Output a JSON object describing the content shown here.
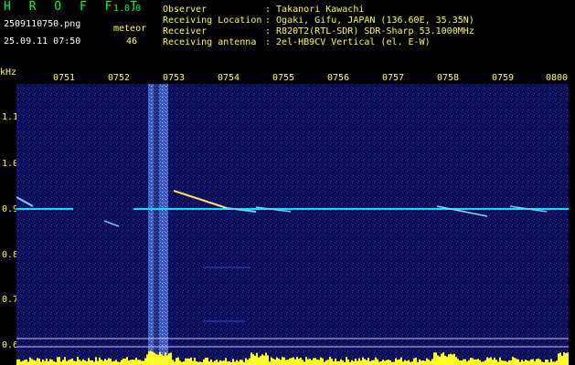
{
  "app": {
    "name": "H R O F F T",
    "version": "1.0.0"
  },
  "file": {
    "name": "2509110750.png",
    "datetime": "25.09.11 07:50"
  },
  "mode": {
    "label": "meteor",
    "count": "46"
  },
  "info": [
    {
      "key": "Observer",
      "value": ": Takanori Kawachi"
    },
    {
      "key": "Receiving Location",
      "value": ": Ogaki, Gifu, JAPAN (136.60E, 35.35N)"
    },
    {
      "key": "Receiver",
      "value": ": R820T2(RTL-SDR) SDR-Sharp 53.1000MHz"
    },
    {
      "key": "Receiving antenna",
      "value": ": 2el-HB9CV Vertical (el. E-W)"
    }
  ],
  "axes": {
    "y_unit": "kHz",
    "y_ticks": [
      "1.1",
      "1.0",
      "0.9",
      "0.8",
      "0.7",
      "0.6"
    ],
    "x_ticks": [
      "0751",
      "0752",
      "0753",
      "0754",
      "0755",
      "0756",
      "0757",
      "0758",
      "0759",
      "0800"
    ]
  },
  "colors": {
    "background": "#000000",
    "spectrum_bg": "#0c0f5a",
    "carrier": "#00e6ff",
    "label": "#ffff40",
    "title": "#00ff3a"
  }
}
